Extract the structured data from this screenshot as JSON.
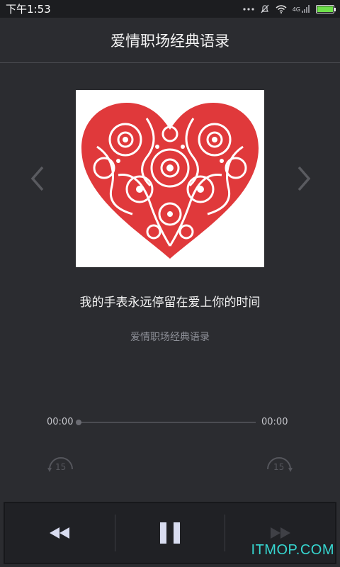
{
  "status": {
    "time": "下午1:53",
    "network_label": "4G"
  },
  "header": {
    "title": "爱情职场经典语录"
  },
  "track": {
    "title": "我的手表永远停留在爱上你的时间",
    "album": "爱情职场经典语录"
  },
  "player": {
    "current_time": "00:00",
    "total_time": "00:00",
    "progress": 0,
    "rewind_seconds": "15",
    "forward_seconds": "15"
  },
  "watermark": "ITMOP.COM",
  "colors": {
    "heart": "#e0393b",
    "accent": "#36d6d0"
  }
}
